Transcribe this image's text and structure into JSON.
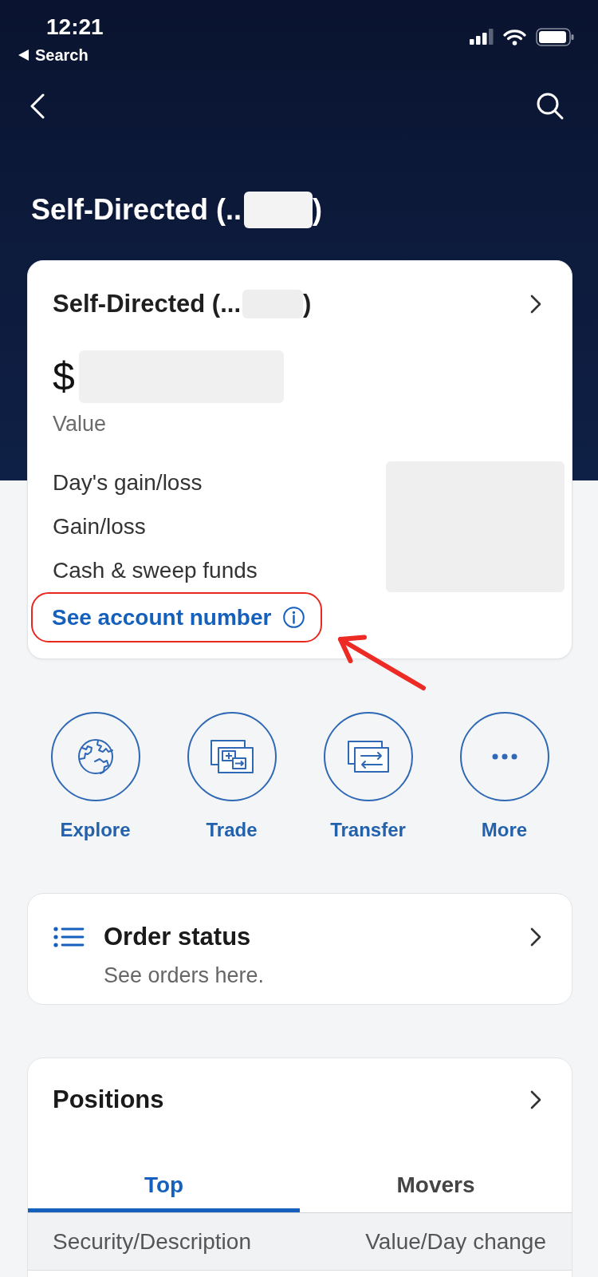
{
  "status_bar": {
    "time": "12:21",
    "back_label": "Search"
  },
  "header": {
    "title": "Self-Directed (..",
    "title_end": ")",
    "redacted": true
  },
  "account_card": {
    "title": "Self-Directed (...",
    "title_end": ")",
    "title_redacted": true,
    "currency": "$",
    "value_redacted": true,
    "value_label": "Value",
    "metrics": [
      "Day's gain/loss",
      "Gain/loss",
      "Cash & sweep funds"
    ],
    "metrics_redacted": true,
    "link": {
      "label": "See account number",
      "annotated": true
    }
  },
  "actions": [
    {
      "kind": "globe",
      "label": "Explore"
    },
    {
      "kind": "cards",
      "label": "Trade"
    },
    {
      "kind": "exchange",
      "label": "Transfer"
    },
    {
      "kind": "dots",
      "label": "More"
    }
  ],
  "order_status": {
    "title": "Order status",
    "subtitle": "See orders here."
  },
  "positions": {
    "title": "Positions",
    "tabs": [
      {
        "label": "Top",
        "selected": true
      },
      {
        "label": "Movers",
        "selected": false
      }
    ],
    "columns": [
      "Security/Description",
      "Value/Day change"
    ]
  }
}
